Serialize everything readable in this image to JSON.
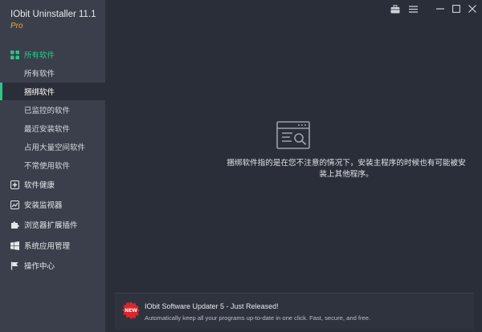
{
  "app": {
    "title": "IObit Uninstaller 11.1",
    "edition": "Pro"
  },
  "sidebar": {
    "all_software": {
      "label": "所有软件",
      "subitems": [
        "所有软件",
        "捆绑软件",
        "已监控的软件",
        "最近安装软件",
        "占用大量空间软件",
        "不常使用软件"
      ]
    },
    "categories": [
      "软件健康",
      "安装监视器",
      "浏览器扩展插件",
      "系统应用管理",
      "操作中心"
    ]
  },
  "main": {
    "empty_message": "捆绑软件指的是在您不注意的情况下，安装主程序的时候也有可能被安装上其他程序。"
  },
  "banner": {
    "badge": "NEW",
    "title": "IObit Software Updater 5 - Just Released!",
    "description": "Automatically keep all your programs up-to-date in one click. Fast, secure, and free."
  },
  "colors": {
    "accent": "#2ec48a",
    "sidebar_bg": "#3a3f4b",
    "main_bg": "#2a2e38",
    "edition": "#f0a830",
    "badge_red": "#d8262c"
  }
}
